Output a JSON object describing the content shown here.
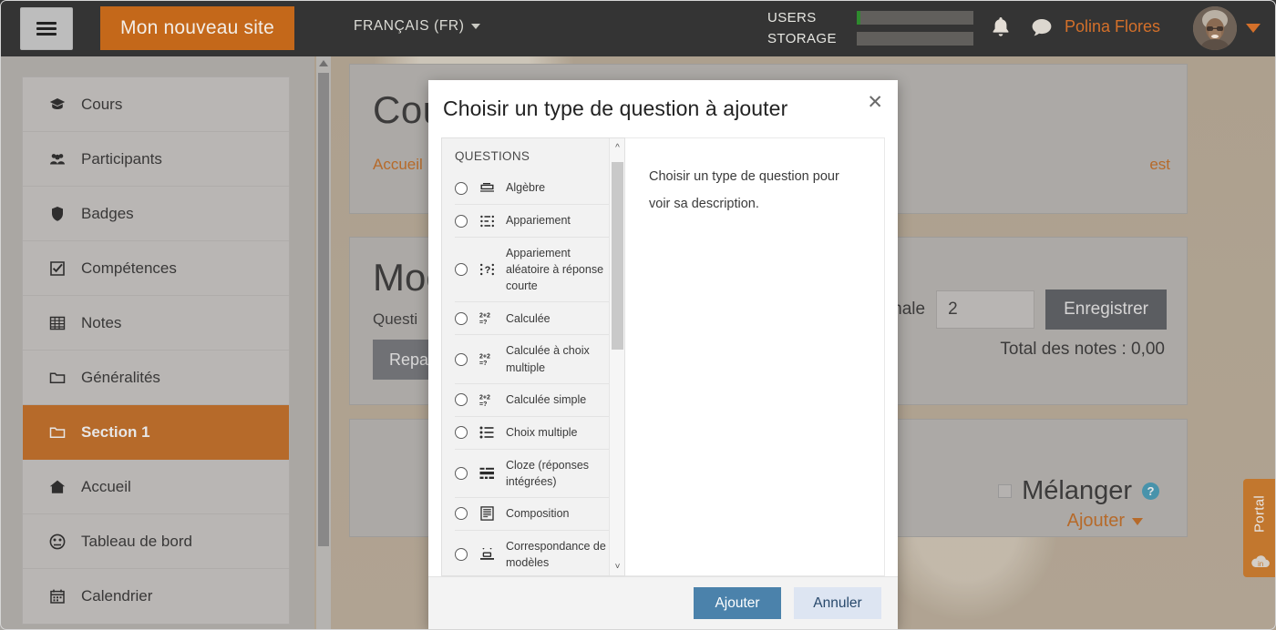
{
  "navbar": {
    "menu_icon": "hamburger-icon",
    "site_name": "Mon nouveau site",
    "language": "FRANÇAIS (FR)",
    "meters": [
      {
        "label": "USERS",
        "fill_percent": 3,
        "fill_color": "#2e8b2e"
      },
      {
        "label": "STORAGE",
        "fill_percent": 0,
        "fill_color": "#2e8b2e"
      }
    ],
    "notifications_icon": "bell-icon",
    "messages_icon": "chat-bubble-icon",
    "user_name": "Polina Flores",
    "avatar": "user-avatar",
    "accent_color": "#c4681a"
  },
  "sidebar": {
    "items": [
      {
        "label": "Cours",
        "icon": "graduation-cap-icon",
        "active": false
      },
      {
        "label": "Participants",
        "icon": "users-icon",
        "active": false
      },
      {
        "label": "Badges",
        "icon": "shield-icon",
        "active": false
      },
      {
        "label": "Compétences",
        "icon": "check-square-icon",
        "active": false
      },
      {
        "label": "Notes",
        "icon": "table-icon",
        "active": false
      },
      {
        "label": "Généralités",
        "icon": "folder-icon",
        "active": false
      },
      {
        "label": "Section 1",
        "icon": "folder-icon",
        "active": true
      },
      {
        "label": "Accueil",
        "icon": "home-icon",
        "active": false
      },
      {
        "label": "Tableau de bord",
        "icon": "dashboard-icon",
        "active": false
      },
      {
        "label": "Calendrier",
        "icon": "calendar-icon",
        "active": false
      }
    ]
  },
  "background": {
    "page_title": "Cou",
    "breadcrumb_home": "Accueil",
    "breadcrumb_tail": "est",
    "section_title": "Moc",
    "section_subtitle": "Questi",
    "repaginate_button": "Repa",
    "max_grade_label": "Note maximale",
    "max_grade_value": "2",
    "save_button": "Enregistrer",
    "total_grades": "Total des notes : 0,00",
    "shuffle_label": "Mélanger",
    "help_icon": "help-circle-icon",
    "add_link": "Ajouter",
    "portal_tab": "Portal"
  },
  "modal": {
    "title": "Choisir un type de question à ajouter",
    "close_icon": "close-icon",
    "list_heading": "QUESTIONS",
    "description": "Choisir un type de question pour voir sa description.",
    "scroll_up_icon": "chevron-up-icon",
    "scroll_down_icon": "chevron-down-icon",
    "question_types": [
      {
        "label": "Algèbre",
        "icon": "algebra-icon",
        "selected": false
      },
      {
        "label": "Appariement",
        "icon": "matching-icon",
        "selected": false
      },
      {
        "label": "Appariement aléatoire à réponse courte",
        "icon": "random-matching-icon",
        "selected": false
      },
      {
        "label": "Calculée",
        "icon": "calculated-icon",
        "selected": false
      },
      {
        "label": "Calculée à choix multiple",
        "icon": "calculated-multichoice-icon",
        "selected": false
      },
      {
        "label": "Calculée simple",
        "icon": "calculated-simple-icon",
        "selected": false
      },
      {
        "label": "Choix multiple",
        "icon": "multichoice-icon",
        "selected": false
      },
      {
        "label": "Cloze (réponses intégrées)",
        "icon": "cloze-icon",
        "selected": false
      },
      {
        "label": "Composition",
        "icon": "essay-icon",
        "selected": false
      },
      {
        "label": "Correspondance de modèles",
        "icon": "pattern-match-icon",
        "selected": false
      }
    ],
    "add_button": "Ajouter",
    "cancel_button": "Annuler"
  }
}
